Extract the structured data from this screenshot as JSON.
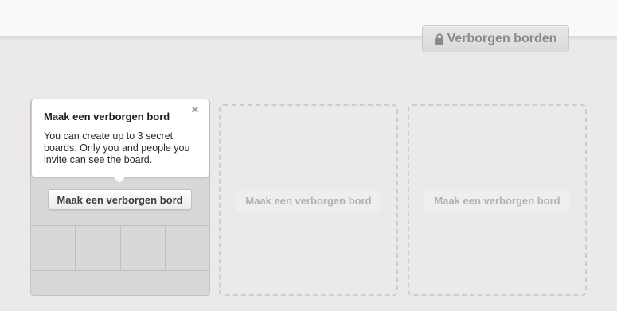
{
  "header": {
    "hidden_boards_button": "Verborgen borden",
    "hidden_boards_icon": "lock-icon"
  },
  "tooltip": {
    "title": "Maak een verborgen bord",
    "text": "You can create up to 3 secret boards. Only you and people you invite can see the board.",
    "close_label": "×"
  },
  "slots": [
    {
      "button_label": "Maak een verborgen bord"
    },
    {
      "button_label": "Maak een verborgen bord"
    },
    {
      "button_label": "Maak een verborgen bord"
    }
  ],
  "colors": {
    "page_bg": "#ebe9e9",
    "topbar_bg": "#f9f9f9",
    "tooltip_bg": "#ffffff"
  }
}
